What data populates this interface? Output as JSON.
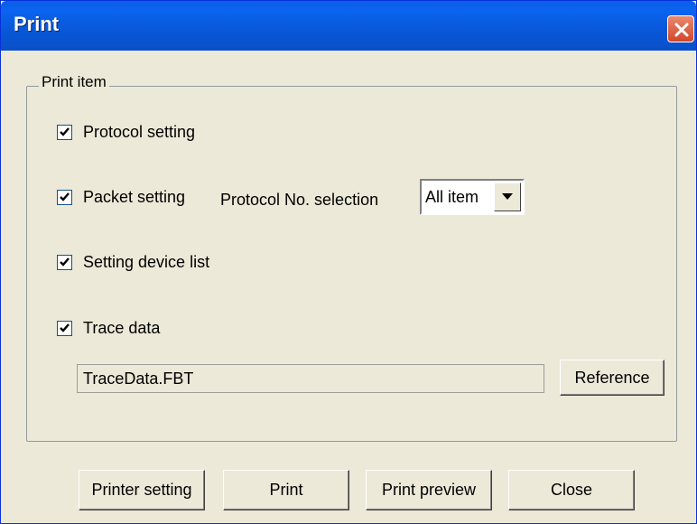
{
  "window": {
    "title": "Print"
  },
  "group": {
    "legend": "Print item",
    "items": [
      {
        "label": "Protocol setting",
        "checked": true
      },
      {
        "label": "Packet setting",
        "checked": true
      },
      {
        "label": "Setting device list",
        "checked": true
      },
      {
        "label": "Trace data",
        "checked": true
      }
    ],
    "protocol_no_label": "Protocol No. selection",
    "protocol_no_value": "All item",
    "trace_file": "TraceData.FBT",
    "reference_label": "Reference"
  },
  "buttons": {
    "printer_setting": "Printer setting",
    "print": "Print",
    "print_preview": "Print preview",
    "close": "Close"
  },
  "colors": {
    "titlebar": "#0a5fe6",
    "dialog_bg": "#ece9d8",
    "close_button": "#d2452a"
  },
  "icons": {
    "close": "close-x-icon",
    "check": "checkmark-icon",
    "dropdown": "triangle-down-icon"
  }
}
